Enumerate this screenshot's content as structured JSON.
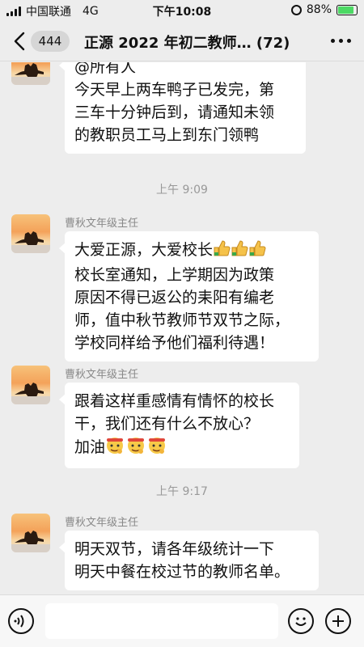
{
  "status_bar": {
    "carrier": "中国联通",
    "network": "4G",
    "time": "下午10:08",
    "battery": "88%",
    "battery_level": 0.88
  },
  "nav": {
    "unread_count": "444",
    "title": "正源 2022 年初二教师… (72)"
  },
  "messages": [
    {
      "sender": "",
      "lines": [
        "@所有人",
        "今天早上两车鸭子已发完，第",
        "三车十分钟后到，请通知未领",
        "的教职员工马上到东门领鸭"
      ]
    },
    {
      "sender": "曹秋文年级主任",
      "lines": [
        "大爱正源，大爱校长",
        "校长室通知，上学期因为政策",
        "原因不得已返公的耒阳有编老",
        "师，值中秋节教师节双节之际，",
        "学校同样给予他们福利待遇！"
      ],
      "emojis": [
        "thumbs-up",
        "thumbs-up",
        "thumbs-up"
      ]
    },
    {
      "sender": "曹秋文年级主任",
      "lines": [
        "跟着这样重感情有情怀的校长",
        "干，我们还有什么不放心？",
        "加油"
      ],
      "emojis": [
        "fighting-face",
        "fighting-face",
        "fighting-face"
      ]
    },
    {
      "sender": "曹秋文年级主任",
      "lines": [
        "明天双节，请各年级统计一下",
        "明天中餐在校过节的教师名单。"
      ]
    }
  ],
  "timestamps": [
    "上午 9:09",
    "上午 9:17"
  ],
  "input_bar": {
    "placeholder": "",
    "icons": [
      "voice-icon",
      "emoji-icon",
      "plus-icon"
    ]
  },
  "colors": {
    "background": "#ededed",
    "bubble": "#ffffff",
    "battery_green": "#4cd964"
  }
}
